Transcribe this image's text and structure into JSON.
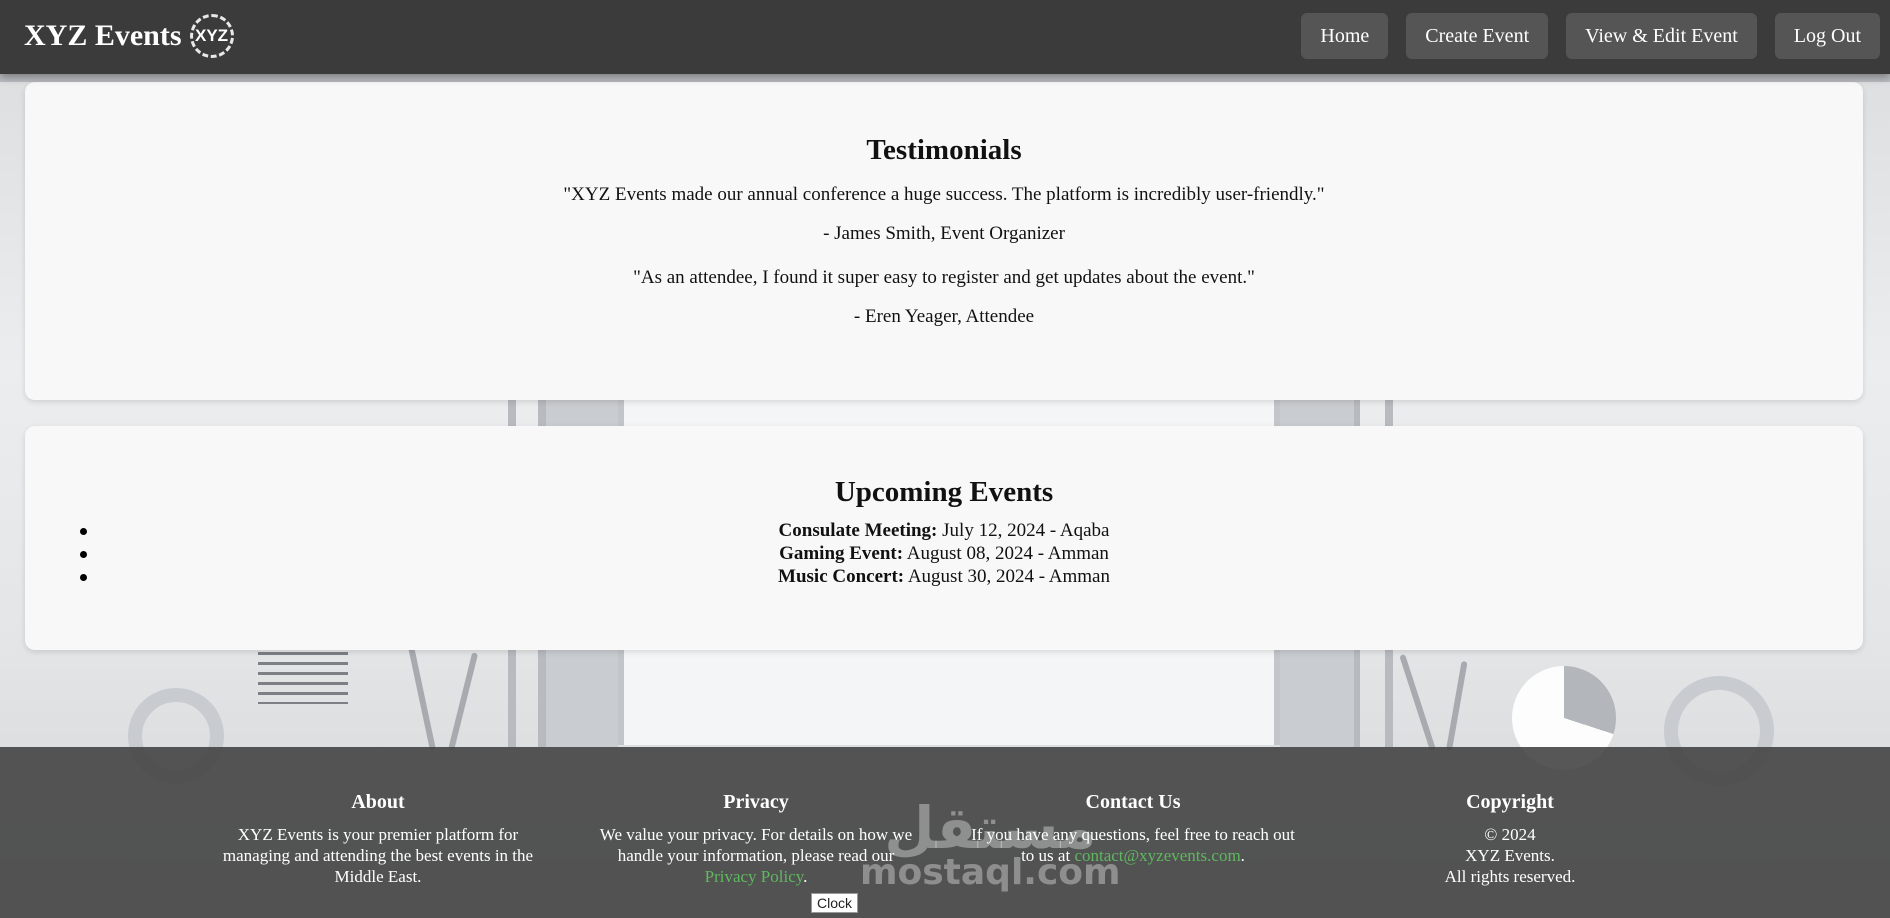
{
  "nav": {
    "brand": "XYZ Events",
    "logo_text": "XYZ",
    "links": [
      "Home",
      "Create Event",
      "View & Edit Event",
      "Log Out"
    ]
  },
  "testimonials": {
    "title": "Testimonials",
    "items": [
      {
        "quote": "\"XYZ Events made our annual conference a huge success. The platform is incredibly user-friendly.\"",
        "author": "- James Smith, Event Organizer"
      },
      {
        "quote": "\"As an attendee, I found it super easy to register and get updates about the event.\"",
        "author": "- Eren Yeager, Attendee"
      }
    ]
  },
  "events": {
    "title": "Upcoming Events",
    "items": [
      {
        "name": "Consulate Meeting:",
        "detail": " July 12, 2024 - Aqaba"
      },
      {
        "name": "Gaming Event:",
        "detail": " August 08, 2024 - Amman"
      },
      {
        "name": "Music Concert:",
        "detail": " August 30, 2024 - Amman"
      }
    ]
  },
  "footer": {
    "about": {
      "title": "About",
      "text": "XYZ Events is your premier platform for managing and attending the best events in the Middle East."
    },
    "privacy": {
      "title": "Privacy",
      "text": "We value your privacy. For details on how we handle your information, please read our ",
      "link": "Privacy Policy",
      "end": "."
    },
    "contact": {
      "title": "Contact Us",
      "text": "If you have any questions, feel free to reach out to us at ",
      "link": "contact@xyzevents.com",
      "end": "."
    },
    "copyright": {
      "title": "Copyright",
      "line1": "© 2024",
      "line2": "XYZ Events.",
      "line3": "All rights reserved."
    }
  },
  "watermark": {
    "arabic": "مستقل",
    "latin": "mostaql.com"
  },
  "clock_label": "Clock",
  "colors": {
    "nav_bg": "#3b3b3b",
    "nav_button": "#555556",
    "card_bg": "#f8f8f8",
    "footer_bg": "#404040",
    "link": "#5fb85f"
  }
}
